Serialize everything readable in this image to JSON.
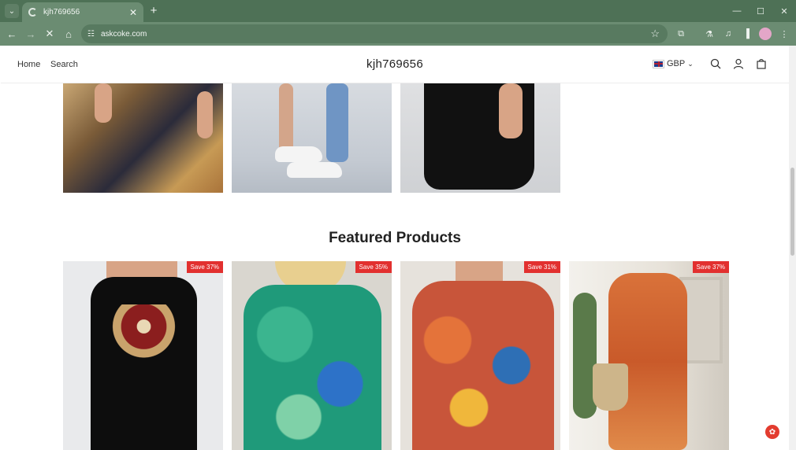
{
  "browser": {
    "tab_title": "kjh769656",
    "url": "askcoke.com"
  },
  "header": {
    "nav": [
      "Home",
      "Search"
    ],
    "brand": "kjh769656",
    "currency": "GBP"
  },
  "featured": {
    "title": "Featured Products",
    "products": [
      {
        "badge": "Save 37%"
      },
      {
        "badge": "Save 35%"
      },
      {
        "badge": "Save 31%"
      },
      {
        "badge": "Save 37%"
      }
    ]
  },
  "icons": {
    "search": "search-icon",
    "account": "user-icon",
    "cart": "cart-icon",
    "chat": "chat-icon"
  }
}
